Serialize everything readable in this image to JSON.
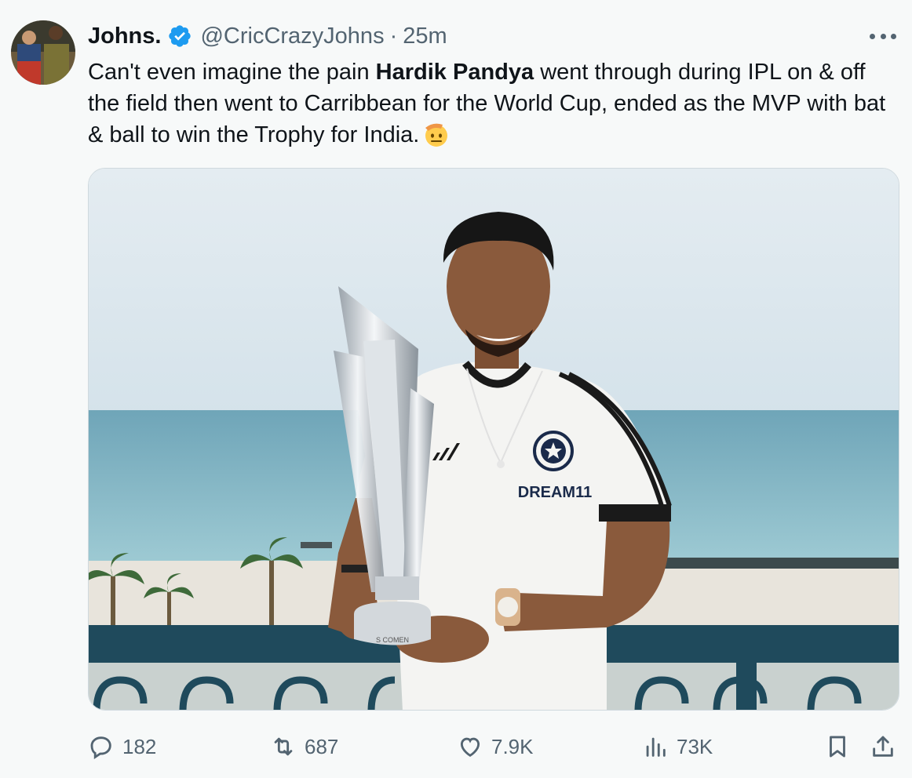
{
  "author": {
    "name": "Johns.",
    "handle": "@CricCrazyJohns",
    "separator": "·",
    "time": "25m"
  },
  "tweet": {
    "text_before": "Can't even imagine the pain ",
    "text_bold": "Hardik Pandya",
    "text_after": " went through during IPL on & off the field then went to Carribbean for the World Cup, ended as the MVP with bat & ball to win the Trophy for India.",
    "emoji": "saluting-face-emoji"
  },
  "media": {
    "jersey_text": "DREAM11",
    "trophy_base_text": "S COMEN"
  },
  "actions": {
    "replies": "182",
    "retweets": "687",
    "likes": "7.9K",
    "views": "73K"
  },
  "icons": {
    "verified": "verified-badge-icon",
    "more": "more-options-icon",
    "reply": "reply-icon",
    "retweet": "retweet-icon",
    "like": "heart-icon",
    "views": "views-icon",
    "bookmark": "bookmark-icon",
    "share": "share-icon"
  },
  "colors": {
    "verified_blue": "#1d9bf0",
    "secondary_text": "#536471",
    "primary_text": "#0f1419"
  }
}
